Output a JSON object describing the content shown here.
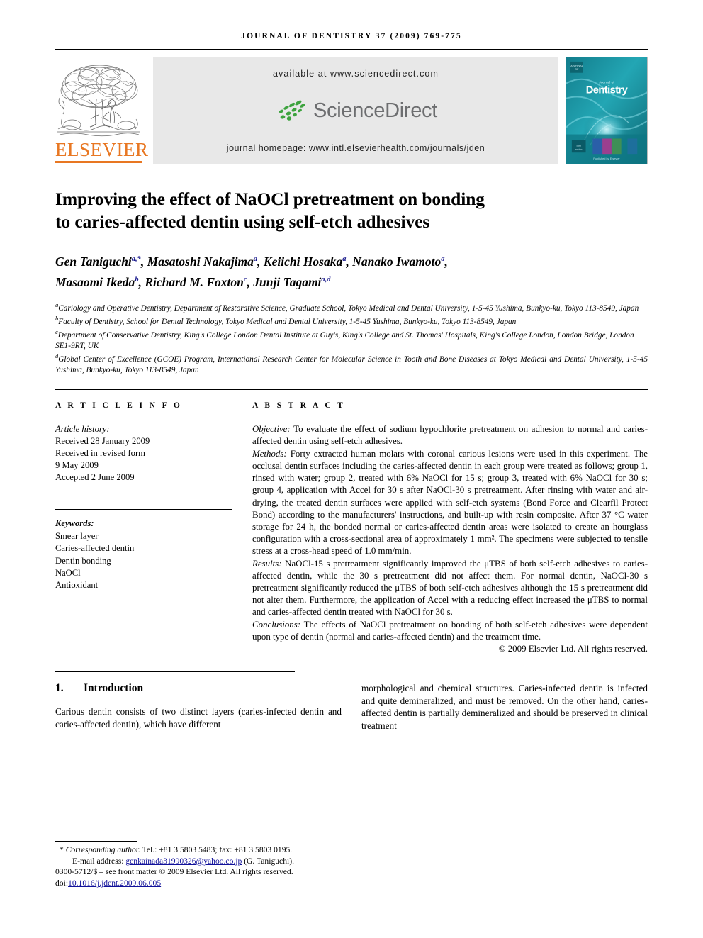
{
  "journal": {
    "header_line": "JOURNAL OF DENTISTRY 37 (2009) 769-775",
    "available_at": "available at www.sciencedirect.com",
    "sciencedirect_word": "ScienceDirect",
    "homepage": "journal homepage: www.intl.elsevierhealth.com/journals/jden",
    "publisher": "ELSEVIER",
    "cover_title": "Dentistry",
    "cover_superscript": "Journal of",
    "cover_footer": "Published by Elsevier"
  },
  "colors": {
    "elsevier_orange": "#E87722",
    "sciencedirect_green": "#3DA33E",
    "sciencedirect_gray": "#6d6e70",
    "link_blue": "#10109a",
    "sup_blue": "#1a1a8c",
    "band_gray": "#e8e8e8",
    "cover_teal": "#1b8f9c"
  },
  "article": {
    "title_line1": "Improving the effect of NaOCl pretreatment on bonding",
    "title_line2": "to caries-affected dentin using self-etch adhesives",
    "authors_line1_parts": [
      {
        "name": "Gen Taniguchi",
        "sup": "a,*"
      },
      {
        "name": "Masatoshi Nakajima",
        "sup": "a"
      },
      {
        "name": "Keiichi Hosaka",
        "sup": "a"
      },
      {
        "name": "Nanako Iwamoto",
        "sup": "a"
      }
    ],
    "authors_line2_parts": [
      {
        "name": "Masaomi Ikeda",
        "sup": "b"
      },
      {
        "name": "Richard M. Foxton",
        "sup": "c"
      },
      {
        "name": "Junji Tagami",
        "sup": "a,d"
      }
    ],
    "affiliations": [
      {
        "mark": "a",
        "text": "Cariology and Operative Dentistry, Department of Restorative Science, Graduate School, Tokyo Medical and Dental University, 1-5-45 Yushima, Bunkyo-ku, Tokyo 113-8549, Japan"
      },
      {
        "mark": "b",
        "text": "Faculty of Dentistry, School for Dental Technology, Tokyo Medical and Dental University, 1-5-45 Yushima, Bunkyo-ku, Tokyo 113-8549, Japan"
      },
      {
        "mark": "c",
        "text": "Department of Conservative Dentistry, King's College London Dental Institute at Guy's, King's College and St. Thomas' Hospitals, King's College London, London Bridge, London SE1-9RT, UK"
      },
      {
        "mark": "d",
        "text": "Global Center of Excellence (GCOE) Program, International Research Center for Molecular Science in Tooth and Bone Diseases at Tokyo Medical and Dental University, 1-5-45 Yushima, Bunkyo-ku, Tokyo 113-8549, Japan"
      }
    ]
  },
  "article_info": {
    "heading": "A R T I C L E    I N F O",
    "history_label": "Article history:",
    "history": [
      "Received 28 January 2009",
      "Received in revised form",
      "9 May 2009",
      "Accepted 2 June 2009"
    ],
    "keywords_label": "Keywords:",
    "keywords": [
      "Smear layer",
      "Caries-affected dentin",
      "Dentin bonding",
      "NaOCl",
      "Antioxidant"
    ]
  },
  "abstract": {
    "heading": "A B S T R A C T",
    "objective_label": "Objective:",
    "objective_text": " To evaluate the effect of sodium hypochlorite pretreatment on adhesion to normal and caries-affected dentin using self-etch adhesives.",
    "methods_label": "Methods:",
    "methods_text": " Forty extracted human molars with coronal carious lesions were used in this experiment. The occlusal dentin surfaces including the caries-affected dentin in each group were treated as follows; group 1, rinsed with water; group 2, treated with 6% NaOCl for 15 s; group 3, treated with 6% NaOCl for 30 s; group 4, application with Accel for 30 s after NaOCl-30 s pretreatment. After rinsing with water and air-drying, the treated dentin surfaces were applied with self-etch systems (Bond Force and Clearfil Protect Bond) according to the manufacturers' instructions, and built-up with resin composite. After 37 °C water storage for 24 h, the bonded normal or caries-affected dentin areas were isolated to create an hourglass configuration with a cross-sectional area of approximately 1 mm². The specimens were subjected to tensile stress at a cross-head speed of 1.0 mm/min.",
    "results_label": "Results:",
    "results_text": " NaOCl-15 s pretreatment significantly improved the μTBS of both self-etch adhesives to caries-affected dentin, while the 30 s pretreatment did not affect them. For normal dentin, NaOCl-30 s pretreatment significantly reduced the μTBS of both self-etch adhesives although the 15 s pretreatment did not alter them. Furthermore, the application of Accel with a reducing effect increased the μTBS to normal and caries-affected dentin treated with NaOCl for 30 s.",
    "conclusions_label": "Conclusions:",
    "conclusions_text": " The effects of NaOCl pretreatment on bonding of both self-etch adhesives were dependent upon type of dentin (normal and caries-affected dentin) and the treatment time.",
    "copyright": "© 2009 Elsevier Ltd. All rights reserved."
  },
  "introduction": {
    "number": "1.",
    "heading": "Introduction",
    "left_text": "Carious dentin consists of two distinct layers (caries-infected dentin and caries-affected dentin), which have different",
    "right_text": "morphological and chemical structures. Caries-infected dentin is infected and quite demineralized, and must be removed. On the other hand, caries-affected dentin is partially demineralized and should be preserved in clinical treatment"
  },
  "footer": {
    "corresponding_label": "Corresponding author.",
    "corresponding_contact": " Tel.: +81 3 5803 5483; fax: +81 3 5803 0195.",
    "email_label": "E-mail address:",
    "email": "genkainada31990326@yahoo.co.jp",
    "email_owner": " (G. Taniguchi).",
    "front_matter": "0300-5712/$ – see front matter © 2009 Elsevier Ltd. All rights reserved.",
    "doi_label": "doi:",
    "doi": "10.1016/j.jdent.2009.06.005"
  }
}
